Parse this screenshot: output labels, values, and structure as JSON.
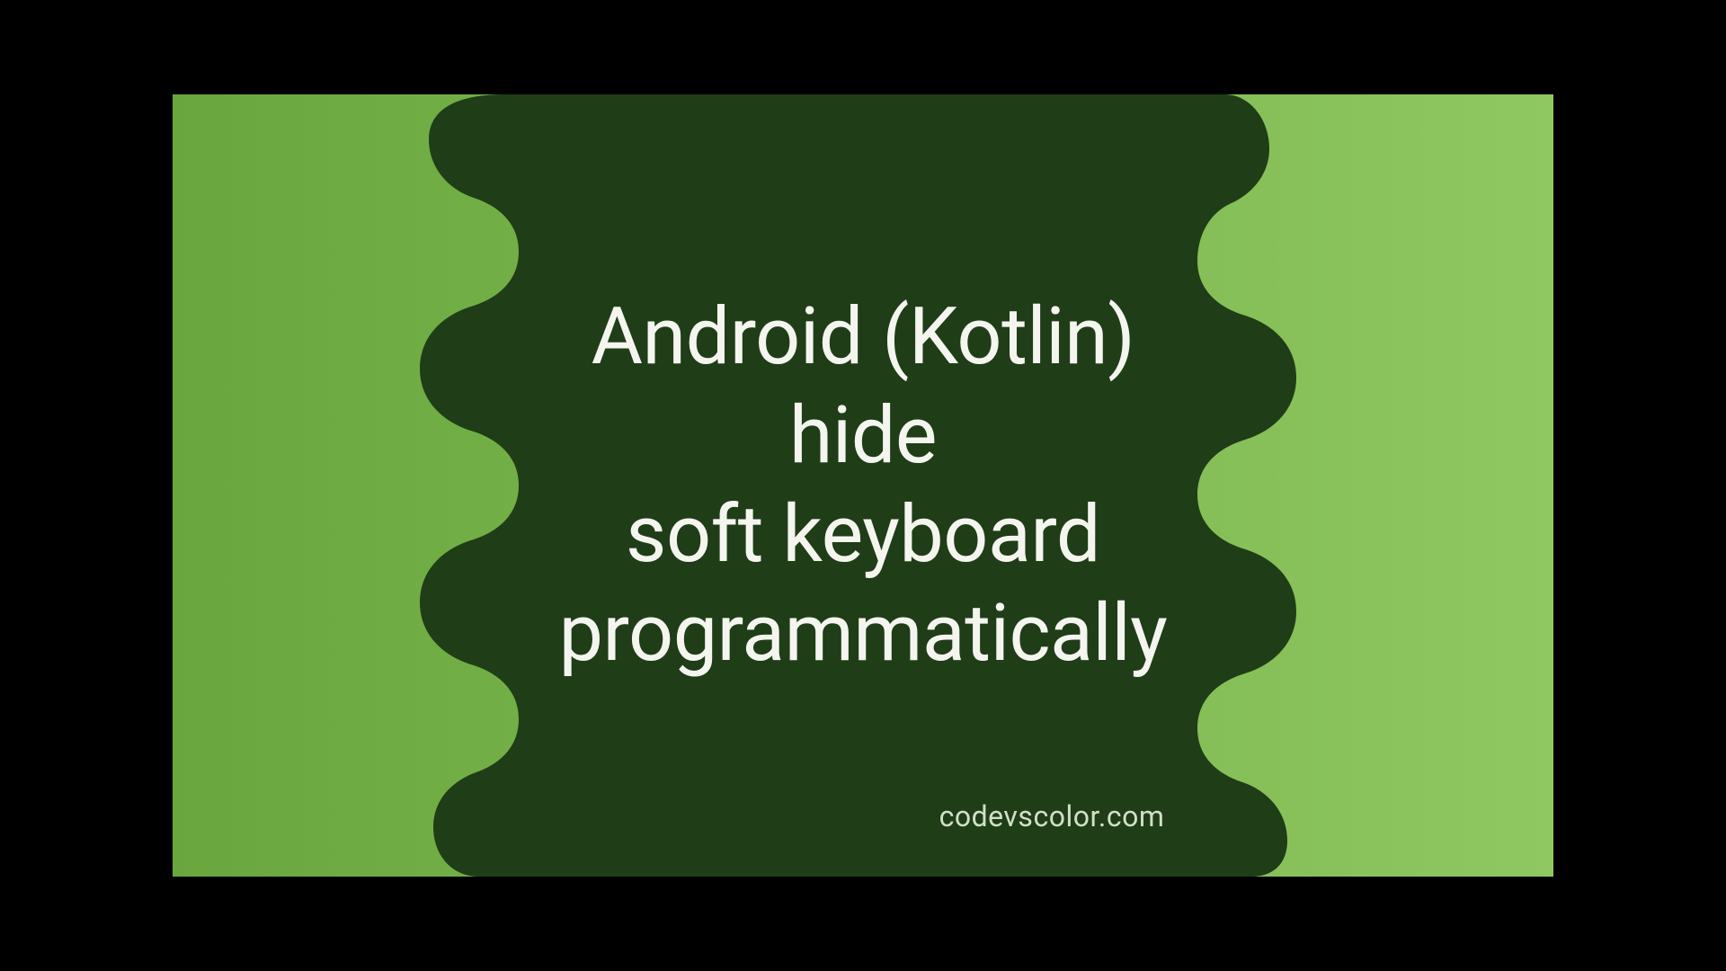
{
  "title": {
    "line1": "Android (Kotlin)",
    "line2": "hide",
    "line3": "soft keyboard",
    "line4": "programmatically"
  },
  "watermark": "codevscolor.com",
  "colors": {
    "gradient_start": "#69a73e",
    "gradient_end": "#8fc760",
    "blob": "#1f3d17",
    "text": "#f5f5f0",
    "watermark_text": "#d0e0c8"
  }
}
